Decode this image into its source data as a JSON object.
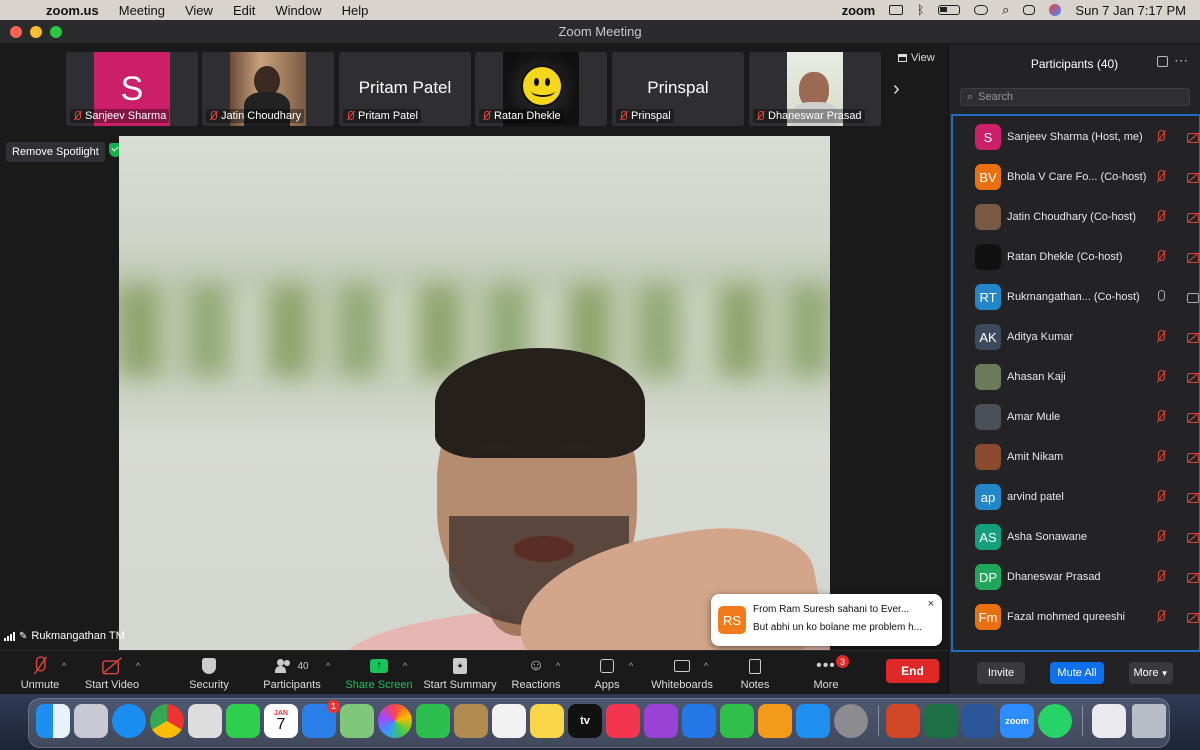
{
  "menubar": {
    "app": "zoom.us",
    "items": [
      "Meeting",
      "View",
      "Edit",
      "Window",
      "Help"
    ],
    "status_app": "zoom",
    "clock": "Sun 7 Jan  7:17 PM"
  },
  "window": {
    "title": "Zoom Meeting"
  },
  "thumbs": [
    {
      "name": "Sanjeev Sharma",
      "initial": "S",
      "big": ""
    },
    {
      "name": "Jatin Choudhary",
      "initial": "",
      "big": ""
    },
    {
      "name": "Pritam Patel",
      "initial": "",
      "big": "Pritam Patel"
    },
    {
      "name": "Ratan Dhekle",
      "initial": "",
      "big": ""
    },
    {
      "name": "Prinspal",
      "initial": "",
      "big": "Prinspal"
    },
    {
      "name": "Dhaneswar Prasad",
      "initial": "",
      "big": ""
    }
  ],
  "view_label": "View",
  "spotlight_label": "Remove Spotlight",
  "speaker_label": "Rukmangathan TM",
  "chat_toast": {
    "avatar": "RS",
    "line1": "From Ram Suresh sahani to Ever...",
    "line2": "But abhi un ko bolane me problem h...",
    "close": "×"
  },
  "toolbar": {
    "unmute": "Unmute",
    "start_video": "Start Video",
    "security": "Security",
    "participants": "Participants",
    "participants_count": "40",
    "share_screen": "Share Screen",
    "start_summary": "Start Summary",
    "reactions": "Reactions",
    "apps": "Apps",
    "whiteboards": "Whiteboards",
    "notes": "Notes",
    "more": "More",
    "more_badge": "3",
    "end": "End"
  },
  "panel": {
    "title": "Participants (40)",
    "search_placeholder": "Search",
    "participants": [
      {
        "initials": "S",
        "name": "Sanjeev Sharma (Host, me)",
        "color": "#cc1f6a",
        "mic": "muted",
        "cam": "off"
      },
      {
        "initials": "BV",
        "name": "Bhola V Care Fo... (Co-host)",
        "color": "#e8700f",
        "mic": "muted",
        "cam": "off"
      },
      {
        "initials": "",
        "name": "Jatin Choudhary (Co-host)",
        "color": "#7a5a44",
        "mic": "muted",
        "cam": "off"
      },
      {
        "initials": "",
        "name": "Ratan Dhekle (Co-host)",
        "color": "#111111",
        "mic": "muted",
        "cam": "off"
      },
      {
        "initials": "RT",
        "name": "Rukmangathan...  (Co-host)",
        "color": "#2386c8",
        "mic": "on",
        "cam": "on"
      },
      {
        "initials": "AK",
        "name": "Aditya Kumar",
        "color": "#3c4a5e",
        "mic": "muted",
        "cam": "off"
      },
      {
        "initials": "",
        "name": "Ahasan Kaji",
        "color": "#6b7b5a",
        "mic": "muted",
        "cam": "off"
      },
      {
        "initials": "",
        "name": "Amar Mule",
        "color": "#4b4f56",
        "mic": "muted",
        "cam": "off"
      },
      {
        "initials": "",
        "name": "Amit Nikam",
        "color": "#8a4a2e",
        "mic": "muted",
        "cam": "off"
      },
      {
        "initials": "ap",
        "name": "arvind patel",
        "color": "#2386c8",
        "mic": "muted",
        "cam": "off"
      },
      {
        "initials": "AS",
        "name": "Asha Sonawane",
        "color": "#14a07a",
        "mic": "muted",
        "cam": "off"
      },
      {
        "initials": "DP",
        "name": "Dhaneswar Prasad",
        "color": "#1fa85a",
        "mic": "muted",
        "cam": "off"
      },
      {
        "initials": "Fm",
        "name": "Fazal mohmed qureeshi",
        "color": "#e8700f",
        "mic": "muted",
        "cam": "off"
      }
    ],
    "invite": "Invite",
    "mute_all": "Mute All",
    "more": "More"
  },
  "dock": {
    "calendar_month": "JAN",
    "calendar_day": "7",
    "mail_badge": "1",
    "tv_label": "tv",
    "zoom_label": "zoom"
  }
}
